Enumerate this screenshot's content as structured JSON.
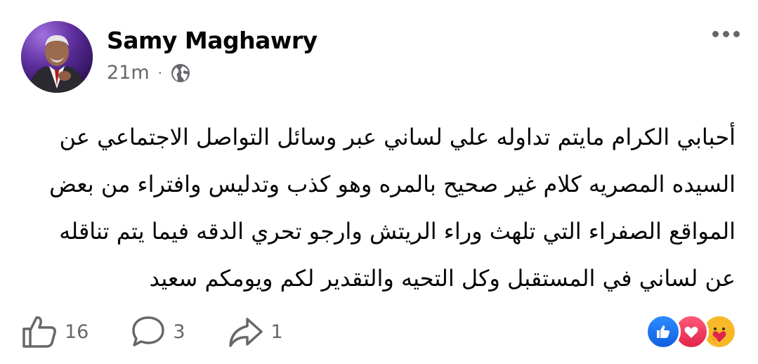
{
  "post": {
    "author": "Samy Maghawry",
    "time": "21m",
    "separator": "·",
    "privacy_icon": "globe-icon",
    "text": "أحبابي الكرام مايتم تداوله علي لساني عبر وسائل التواصل الاجتماعي عن\nالسيده المصريه كلام غير صحيح بالمره وهو كذب وتدليس  وافتراء من بعض\nالمواقع الصفراء  التي تلهث وراء الريتش وارجو تحري الدقه فيما يتم تناقله\nعن لساني في المستقبل وكل التحيه والتقدير لكم ويومكم سعيد"
  },
  "actions": {
    "like_count": "16",
    "comment_count": "3",
    "share_count": "1"
  },
  "reactions": [
    "like-icon",
    "love-icon",
    "care-icon"
  ],
  "colors": {
    "text": "#050505",
    "secondary": "#65676b",
    "like_blue": "#1877f2",
    "love_red": "#e0244a",
    "care_yellow": "#f7b928"
  }
}
